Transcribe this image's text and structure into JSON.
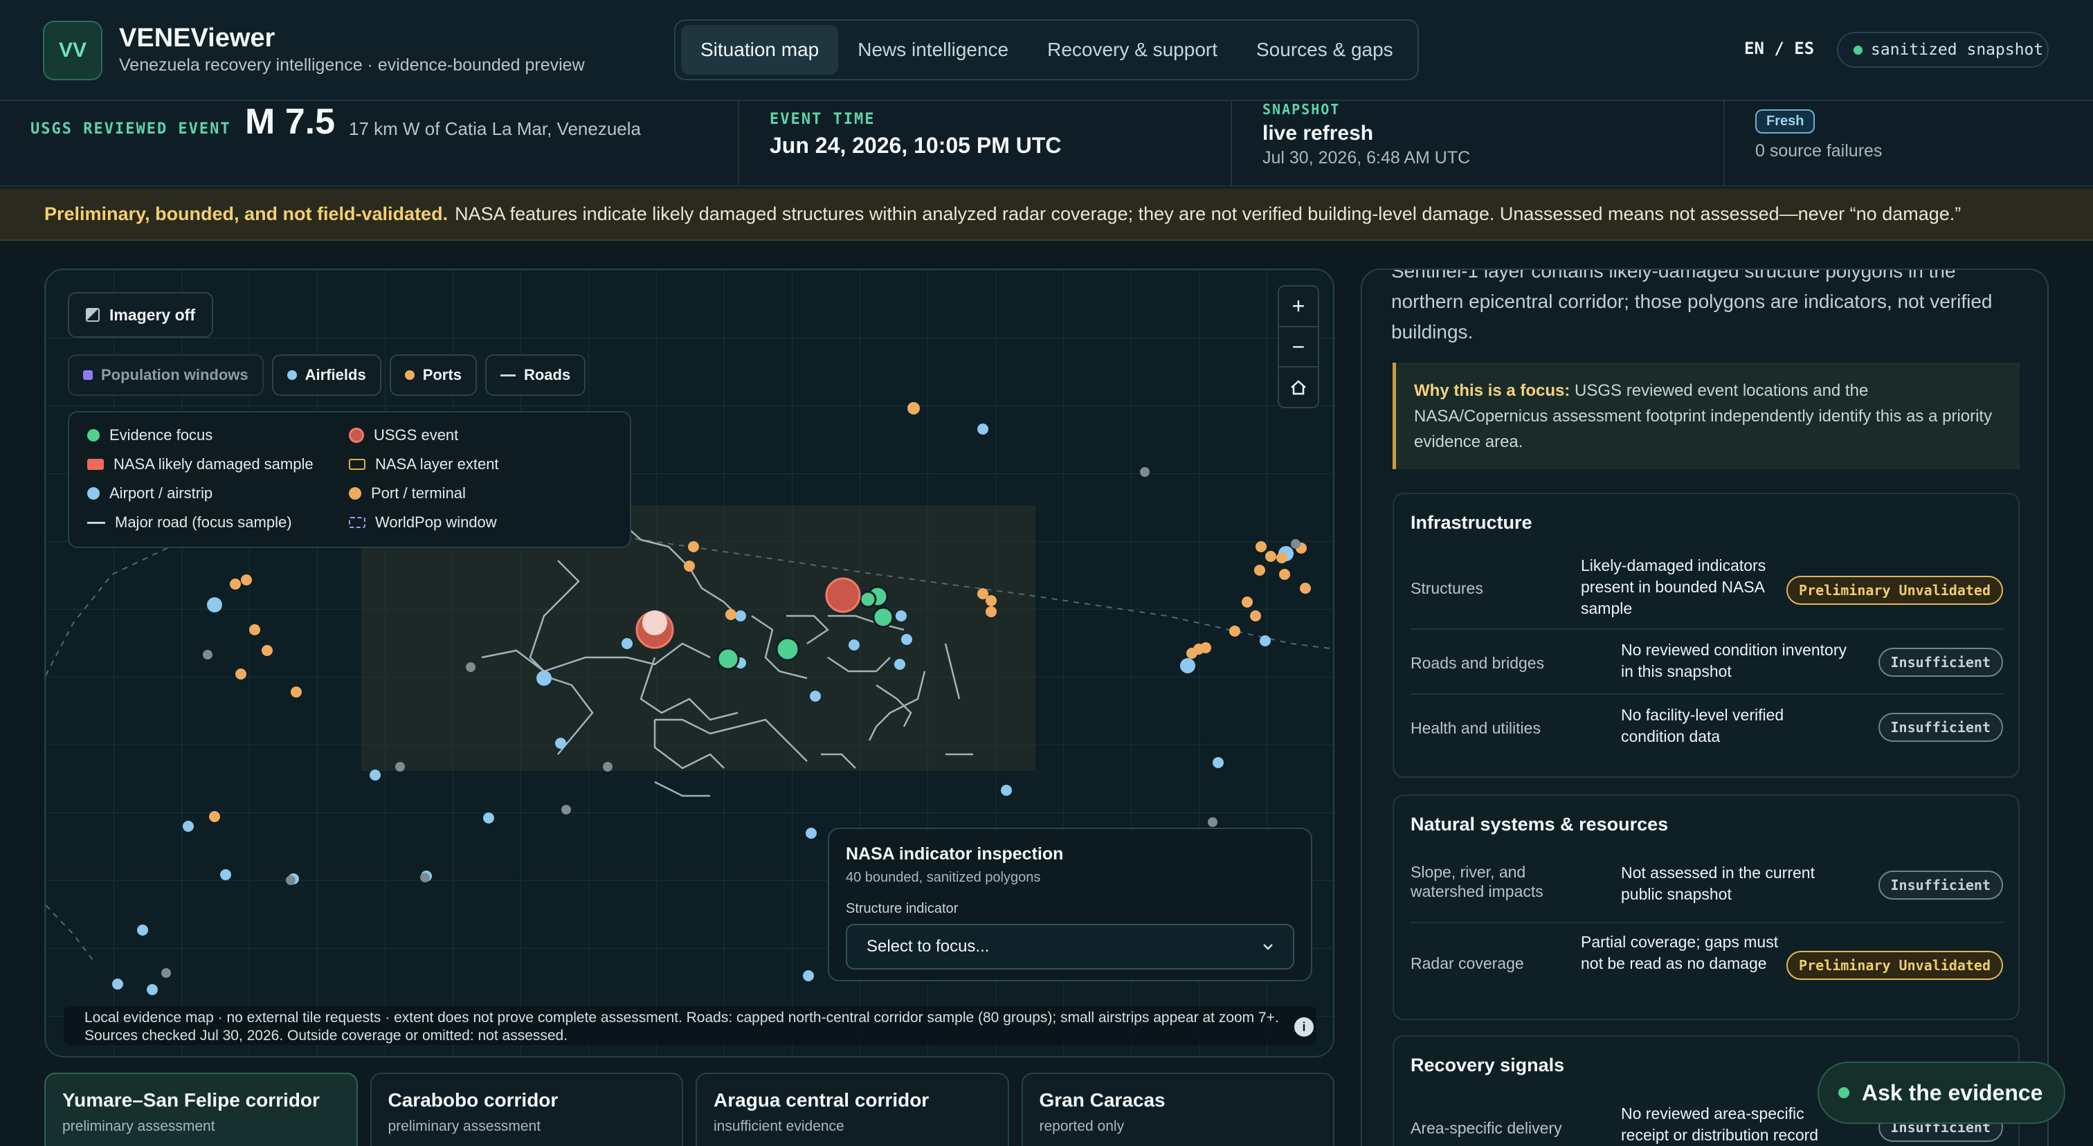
{
  "app": {
    "logo": "VV",
    "title": "VENEViewer",
    "subtitle": "Venezuela recovery intelligence · evidence-bounded preview"
  },
  "tabs": [
    {
      "label": "Situation map",
      "active": true
    },
    {
      "label": "News intelligence",
      "active": false
    },
    {
      "label": "Recovery & support",
      "active": false
    },
    {
      "label": "Sources & gaps",
      "active": false
    }
  ],
  "lang": "EN / ES",
  "snapshot_pill": "sanitized snapshot",
  "event": {
    "label": "USGS REVIEWED EVENT",
    "magnitude": "M 7.5",
    "place": "17 km W of Catia La Mar, Venezuela",
    "time_label": "EVENT TIME",
    "time": "Jun 24, 2026, 10:05 PM UTC",
    "snapshot_label": "SNAPSHOT",
    "snapshot_value": "live refresh",
    "snapshot_time": "Jul 30, 2026, 6:48 AM UTC",
    "freshness": "Fresh",
    "failures": "0 source failures"
  },
  "warning": {
    "bold": "Preliminary, bounded, and not field-validated.",
    "text": "NASA features indicate likely damaged structures within analyzed radar coverage; they are not verified building-level damage. Unassessed means not assessed—never “no damage.”"
  },
  "map": {
    "imagery_button": "Imagery off",
    "layers": [
      {
        "label": "Population windows",
        "color": "#8d7cf0",
        "on": false
      },
      {
        "label": "Airfields",
        "color": "#8dc9f0",
        "on": true
      },
      {
        "label": "Ports",
        "color": "#f0ac5e",
        "on": true
      },
      {
        "label": "Roads",
        "color": "#c6d6dc",
        "on": true
      }
    ],
    "legend": [
      {
        "label": "Evidence focus",
        "color": "#4fd090"
      },
      {
        "label": "USGS event",
        "color": "#f06a5a"
      },
      {
        "label": "NASA likely damaged sample",
        "color": "#ee6a5a"
      },
      {
        "label": "NASA layer extent",
        "color": "#e0b040"
      },
      {
        "label": "Airport / airstrip",
        "color": "#8dc9f0"
      },
      {
        "label": "Port / terminal",
        "color": "#f0ac5e"
      },
      {
        "label": "Major road (focus sample)",
        "color": "#c6d6dc"
      },
      {
        "label": "WorldPop window",
        "color": "#a898f0"
      }
    ],
    "zoom_in": "+",
    "zoom_out": "−",
    "home_icon": "home-icon",
    "inspection": {
      "title": "NASA indicator inspection",
      "subtitle": "40 bounded, sanitized polygons",
      "field_label": "Structure indicator",
      "placeholder": "Select to focus..."
    },
    "attribution": "Local evidence map · no external tile requests · extent does not prove complete assessment. Roads: capped north-central corridor sample (80 groups); small airstrips appear at zoom 7+. Sources checked Jul 30, 2026. Outside coverage or omitted: not assessed."
  },
  "regions": [
    {
      "title": "Yumare–San Felipe corridor",
      "status": "preliminary assessment",
      "active": true
    },
    {
      "title": "Carabobo corridor",
      "status": "preliminary assessment",
      "active": false
    },
    {
      "title": "Aragua central corridor",
      "status": "insufficient evidence",
      "active": false
    },
    {
      "title": "Gran Caracas",
      "status": "reported only",
      "active": false
    }
  ],
  "panel": {
    "intro": "Sentinel-1 layer contains likely-damaged structure polygons in the northern epicentral corridor; those polygons are indicators, not verified buildings.",
    "focus_bold": "Why this is a focus:",
    "focus_text": "USGS reviewed event locations and the NASA/Copernicus assessment footprint independently identify this as a priority evidence area.",
    "sections": [
      {
        "title": "Infrastructure",
        "rows": [
          {
            "name": "Structures",
            "value": "Likely-damaged indicators present in bounded NASA sample",
            "badge": "Preliminary Unvalidated",
            "kind": "prelim"
          },
          {
            "name": "Roads and bridges",
            "value": "No reviewed condition inventory in this snapshot",
            "badge": "Insufficient",
            "kind": "insuf"
          },
          {
            "name": "Health and utilities",
            "value": "No facility-level verified condition data",
            "badge": "Insufficient",
            "kind": "insuf"
          }
        ]
      },
      {
        "title": "Natural systems & resources",
        "rows": [
          {
            "name": "Slope, river, and watershed impacts",
            "value": "Not assessed in the current public snapshot",
            "badge": "Insufficient",
            "kind": "insuf"
          },
          {
            "name": "Radar coverage",
            "value": "Partial coverage; gaps must not be read as no damage",
            "badge": "Preliminary Unvalidated",
            "kind": "prelim"
          }
        ]
      },
      {
        "title": "Recovery signals",
        "rows": [
          {
            "name": "Area-specific delivery",
            "value": "No reviewed area-specific receipt or distribution record",
            "badge": "Insufficient",
            "kind": "insuf"
          }
        ]
      }
    ]
  },
  "ask_button": "Ask the evidence"
}
